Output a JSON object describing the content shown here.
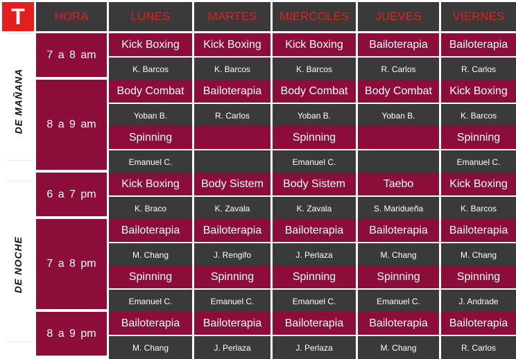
{
  "logo": "T",
  "headers": [
    "HORA",
    "LUNES",
    "MARTES",
    "MIERCOLES",
    "JUEVES",
    "VIERNES"
  ],
  "periods": [
    "DE MAÑANA",
    "DE NOCHE"
  ],
  "times": [
    "7 a 8 am",
    "8 a 9 am",
    "6 a 7 pm",
    "7 a 8 pm",
    "8 a 9 pm"
  ],
  "rows": [
    {
      "classes": [
        "Kick Boxing",
        "Kick Boxing",
        "Kick Boxing",
        "Bailoterapia",
        "Bailoterapia"
      ],
      "instructors": [
        "K. Barcos",
        "K. Barcos",
        "K. Barcos",
        "R. Carlos",
        "R. Carlos"
      ]
    },
    {
      "classes": [
        "Body Combat",
        "Bailoterapia",
        "Body Combat",
        "Body Combat",
        "Kick Boxing"
      ],
      "instructors": [
        "Yoban B.",
        "R. Carlos",
        "Yoban B.",
        "Yoban B.",
        "K. Barcos"
      ]
    },
    {
      "classes": [
        "Spinning",
        "",
        "Spinning",
        "",
        "Spinning"
      ],
      "instructors": [
        "Emanuel C.",
        "",
        "Emanuel C.",
        "",
        "Emanuel C."
      ]
    },
    {
      "classes": [
        "Kick Boxing",
        "Body Sistem",
        "Body Sistem",
        "Taebo",
        "Kick Boxing"
      ],
      "instructors": [
        "K. Braco",
        "K. Zavala",
        "K. Zavala",
        "S. Maridueña",
        "K. Barcos"
      ]
    },
    {
      "classes": [
        "Bailoterapia",
        "Bailoterapia",
        "Bailoterapia",
        "Bailoterapia",
        "Bailoterapia"
      ],
      "instructors": [
        "M. Chang",
        "J. Rengifo",
        "J. Perlaza",
        "M. Chang",
        "M. Chang"
      ]
    },
    {
      "classes": [
        "Spinning",
        "Spinning",
        "Spinning",
        "Spinning",
        "Spinning"
      ],
      "instructors": [
        "Emanuel C.",
        "Emanuel C.",
        "Emanuel C.",
        "Emanuel C.",
        "J. Andrade"
      ]
    },
    {
      "classes": [
        "Bailoterapia",
        "Bailoterapia",
        "Bailoterapia",
        "Bailoterapia",
        "Bailoterapia"
      ],
      "instructors": [
        "M. Chang",
        "J. Perlaza",
        "J. Perlaza",
        "M. Chang",
        "R. Carlos"
      ]
    }
  ],
  "colors": {
    "class_bg": "#8c0c3a",
    "instructor_bg": "#3a3a3a",
    "header_text": "#e41e1e",
    "logo_bg": "#e41e1e"
  }
}
